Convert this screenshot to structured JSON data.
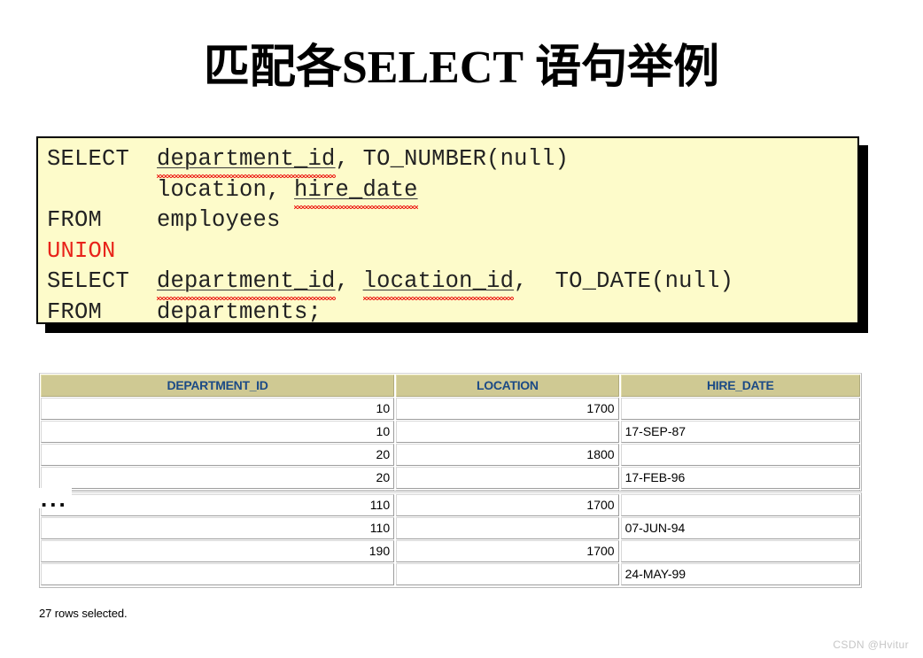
{
  "slide": {
    "title_prefix": "匹配各",
    "title_keyword": "SELECT",
    "title_suffix": " 语句举例",
    "watermark": "CSDN @Hvitur"
  },
  "code": {
    "lines": [
      {
        "parts": [
          {
            "text": "SELECT  ",
            "style": "plain"
          },
          {
            "text": "department_id",
            "style": "squiggly"
          },
          {
            "text": ", TO_NUMBER(null)",
            "style": "plain"
          }
        ]
      },
      {
        "parts": [
          {
            "text": "        location, ",
            "style": "plain"
          },
          {
            "text": "hire_date",
            "style": "squiggly"
          }
        ]
      },
      {
        "parts": [
          {
            "text": "FROM    employees",
            "style": "plain"
          }
        ]
      },
      {
        "parts": [
          {
            "text": "UNION",
            "style": "keyword-red"
          }
        ]
      },
      {
        "parts": [
          {
            "text": "SELECT  ",
            "style": "plain"
          },
          {
            "text": "department_id",
            "style": "squiggly"
          },
          {
            "text": ", ",
            "style": "plain"
          },
          {
            "text": "location_id",
            "style": "squiggly"
          },
          {
            "text": ",  TO_DATE(null)",
            "style": "plain"
          }
        ]
      },
      {
        "parts": [
          {
            "text": "FROM    departments;",
            "style": "plain"
          }
        ]
      }
    ]
  },
  "result": {
    "columns": [
      "DEPARTMENT_ID",
      "LOCATION",
      "HIRE_DATE"
    ],
    "rows_top": [
      [
        "10",
        "1700",
        ""
      ],
      [
        "10",
        "",
        "17-SEP-87"
      ],
      [
        "20",
        "1800",
        ""
      ],
      [
        "20",
        "",
        "17-FEB-96"
      ],
      [
        "",
        "",
        ""
      ]
    ],
    "ellipsis": "...",
    "rows_bottom": [
      [
        "110",
        "1700",
        ""
      ],
      [
        "110",
        "",
        "07-JUN-94"
      ],
      [
        "190",
        "1700",
        ""
      ],
      [
        "",
        "",
        "24-MAY-99"
      ]
    ],
    "status": "27 rows selected."
  },
  "colors": {
    "code_background": "#fdfbca",
    "code_keyword_red": "#e8231a",
    "table_header_background": "#cfc993",
    "table_header_text": "#1b4a86",
    "spellcheck_underline": "#ee2b22",
    "watermark_text": "#c6c6c6"
  }
}
